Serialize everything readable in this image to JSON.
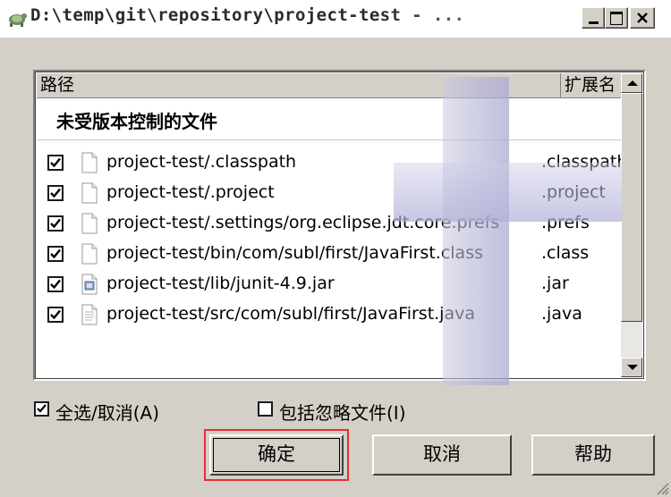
{
  "window": {
    "title": "D:\\temp\\git\\repository\\project-test - ...",
    "icon": "git-turtle-icon",
    "controls": [
      "minimize",
      "maximize",
      "close"
    ]
  },
  "table": {
    "columns": {
      "path": "路径",
      "extension": "扩展名"
    },
    "group_label": "未受版本控制的文件",
    "rows": [
      {
        "checked": true,
        "path": "project-test/.classpath",
        "extension": ".classpath",
        "icon": "file-icon"
      },
      {
        "checked": true,
        "path": "project-test/.project",
        "extension": ".project",
        "icon": "file-icon"
      },
      {
        "checked": true,
        "path": "project-test/.settings/org.eclipse.jdt.core.prefs",
        "extension": ".prefs",
        "icon": "file-icon"
      },
      {
        "checked": true,
        "path": "project-test/bin/com/subl/first/JavaFirst.class",
        "extension": ".class",
        "icon": "file-icon"
      },
      {
        "checked": true,
        "path": "project-test/lib/junit-4.9.jar",
        "extension": ".jar",
        "icon": "jar-file-icon"
      },
      {
        "checked": true,
        "path": "project-test/src/com/subl/first/JavaFirst.java",
        "extension": ".java",
        "icon": "text-file-icon"
      }
    ]
  },
  "options": {
    "select_all": {
      "label": "全选/取消(A)",
      "checked": true
    },
    "include_ignored": {
      "label": "包括忽略文件(I)",
      "checked": false
    }
  },
  "buttons": {
    "ok": "确定",
    "cancel": "取消",
    "help": "帮助"
  },
  "colors": {
    "window_bg": "#d4d0c8",
    "highlight_box": "#e53030"
  }
}
